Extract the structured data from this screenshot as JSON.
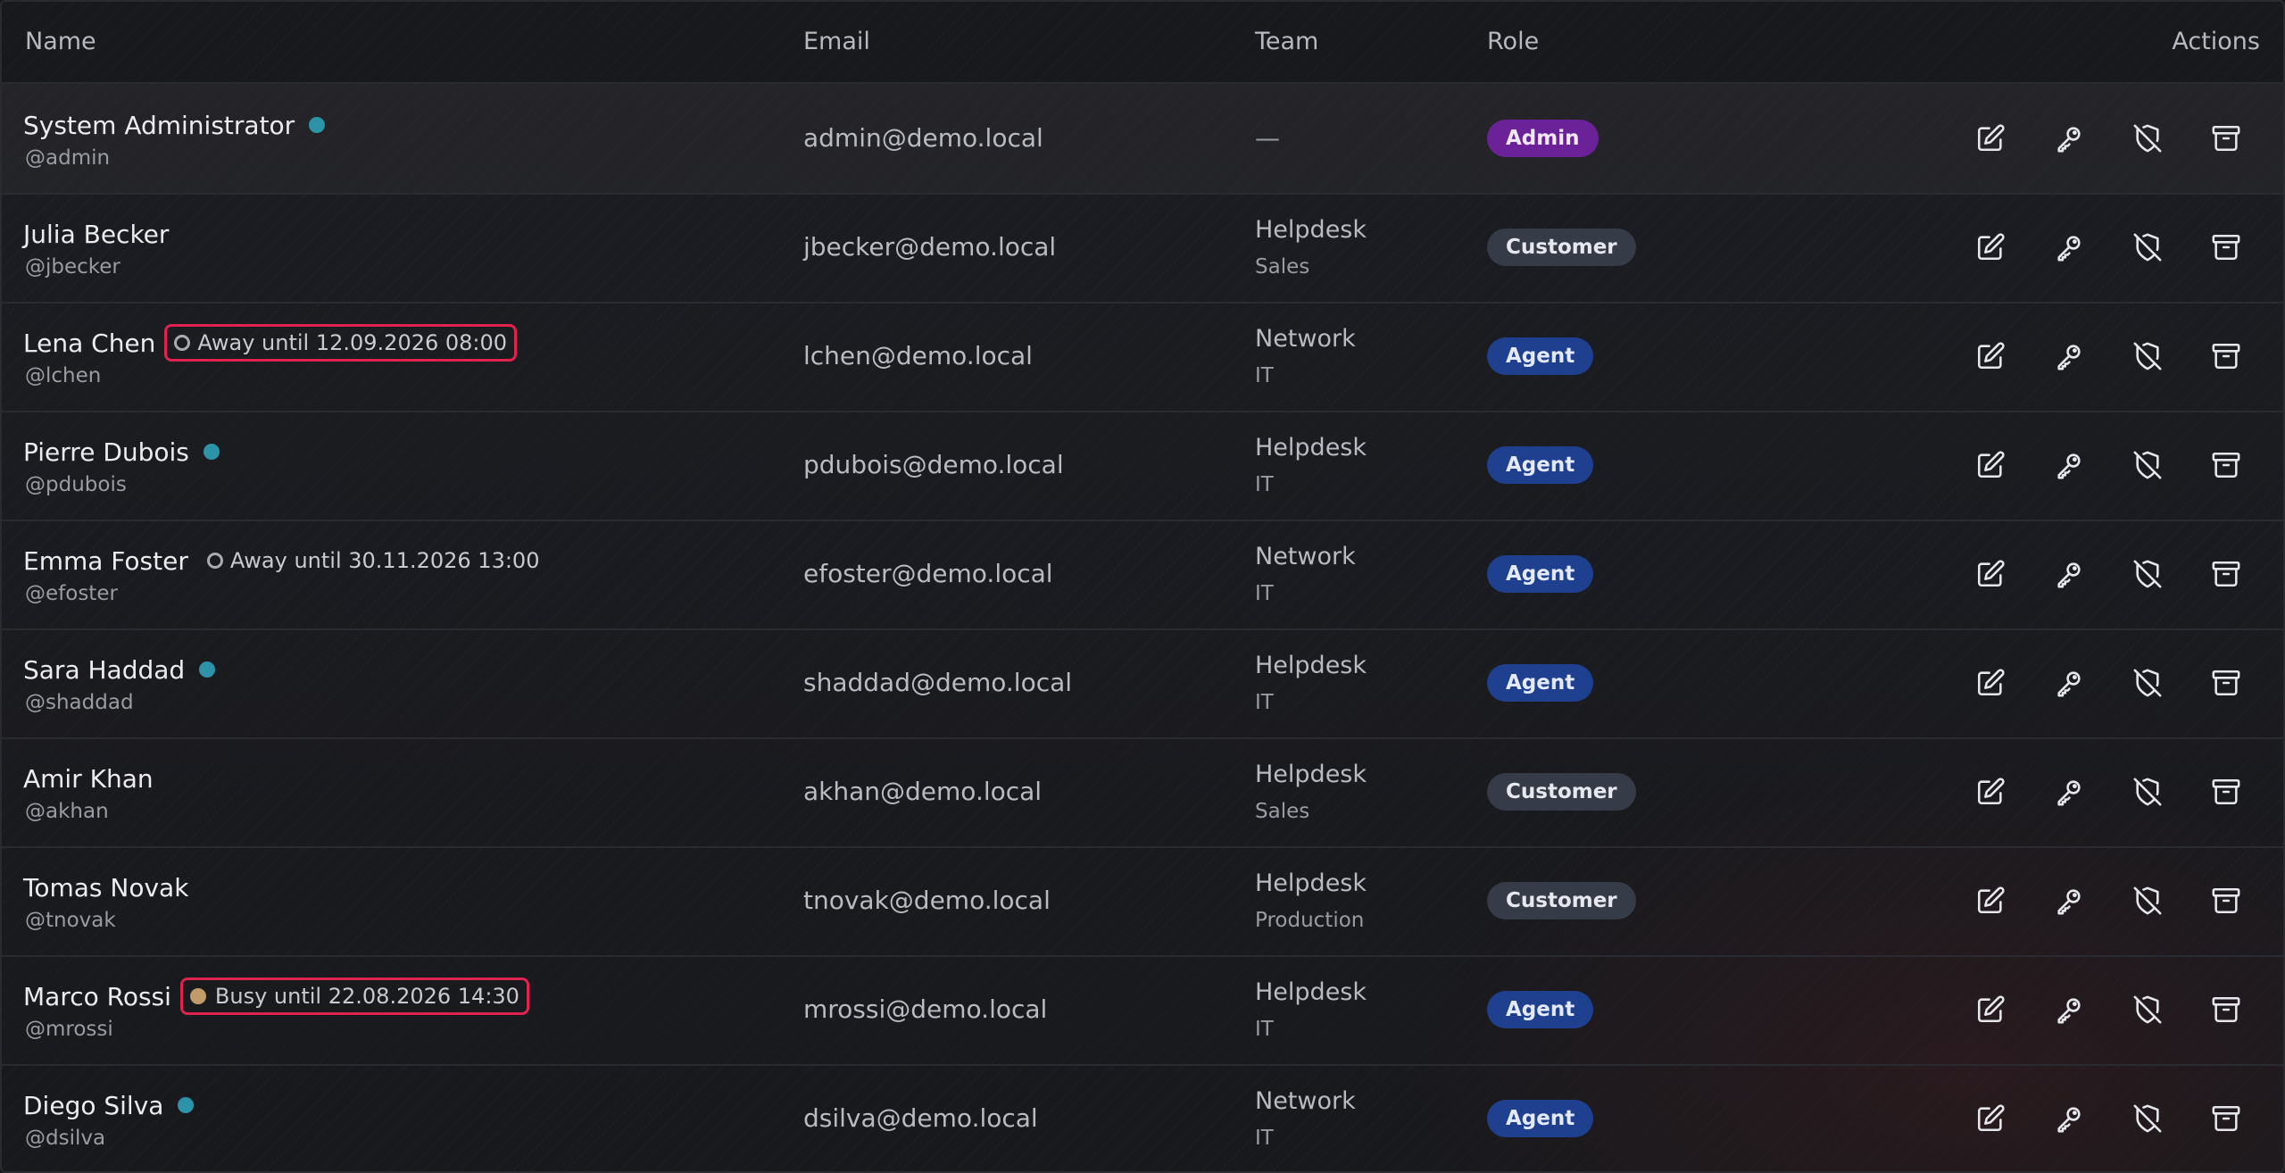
{
  "columns": {
    "name": "Name",
    "email": "Email",
    "team": "Team",
    "role": "Role",
    "actions": "Actions"
  },
  "colors": {
    "online": "#2d93a8",
    "away": "#a9abb3",
    "busy": "#c19c6a",
    "highlight": "#e0224e",
    "admin_badge": "#6b2299",
    "agent_badge": "#1f3f8f",
    "customer_badge": "#353b47"
  },
  "action_icons": [
    "edit-icon",
    "key-icon",
    "shield-off-icon",
    "archive-icon"
  ],
  "users": [
    {
      "name": "System Administrator",
      "handle": "@admin",
      "presence": "online",
      "status_text": "",
      "email": "admin@demo.local",
      "team": "—",
      "dept": "",
      "role": "Admin",
      "role_key": "admin",
      "highlighted": false
    },
    {
      "name": "Julia Becker",
      "handle": "@jbecker",
      "presence": "none",
      "status_text": "",
      "email": "jbecker@demo.local",
      "team": "Helpdesk",
      "dept": "Sales",
      "role": "Customer",
      "role_key": "customer",
      "highlighted": false
    },
    {
      "name": "Lena Chen",
      "handle": "@lchen",
      "presence": "away",
      "status_text": "Away until 12.09.2026 08:00",
      "email": "lchen@demo.local",
      "team": "Network",
      "dept": "IT",
      "role": "Agent",
      "role_key": "agent",
      "highlighted": true
    },
    {
      "name": "Pierre Dubois",
      "handle": "@pdubois",
      "presence": "online",
      "status_text": "",
      "email": "pdubois@demo.local",
      "team": "Helpdesk",
      "dept": "IT",
      "role": "Agent",
      "role_key": "agent",
      "highlighted": false
    },
    {
      "name": "Emma Foster",
      "handle": "@efoster",
      "presence": "away",
      "status_text": "Away until 30.11.2026 13:00",
      "email": "efoster@demo.local",
      "team": "Network",
      "dept": "IT",
      "role": "Agent",
      "role_key": "agent",
      "highlighted": false
    },
    {
      "name": "Sara Haddad",
      "handle": "@shaddad",
      "presence": "online",
      "status_text": "",
      "email": "shaddad@demo.local",
      "team": "Helpdesk",
      "dept": "IT",
      "role": "Agent",
      "role_key": "agent",
      "highlighted": false
    },
    {
      "name": "Amir Khan",
      "handle": "@akhan",
      "presence": "none",
      "status_text": "",
      "email": "akhan@demo.local",
      "team": "Helpdesk",
      "dept": "Sales",
      "role": "Customer",
      "role_key": "customer",
      "highlighted": false
    },
    {
      "name": "Tomas Novak",
      "handle": "@tnovak",
      "presence": "none",
      "status_text": "",
      "email": "tnovak@demo.local",
      "team": "Helpdesk",
      "dept": "Production",
      "role": "Customer",
      "role_key": "customer",
      "highlighted": false
    },
    {
      "name": "Marco Rossi",
      "handle": "@mrossi",
      "presence": "busy",
      "status_text": "Busy until 22.08.2026 14:30",
      "email": "mrossi@demo.local",
      "team": "Helpdesk",
      "dept": "IT",
      "role": "Agent",
      "role_key": "agent",
      "highlighted": true
    },
    {
      "name": "Diego Silva",
      "handle": "@dsilva",
      "presence": "online",
      "status_text": "",
      "email": "dsilva@demo.local",
      "team": "Network",
      "dept": "IT",
      "role": "Agent",
      "role_key": "agent",
      "highlighted": false
    }
  ]
}
